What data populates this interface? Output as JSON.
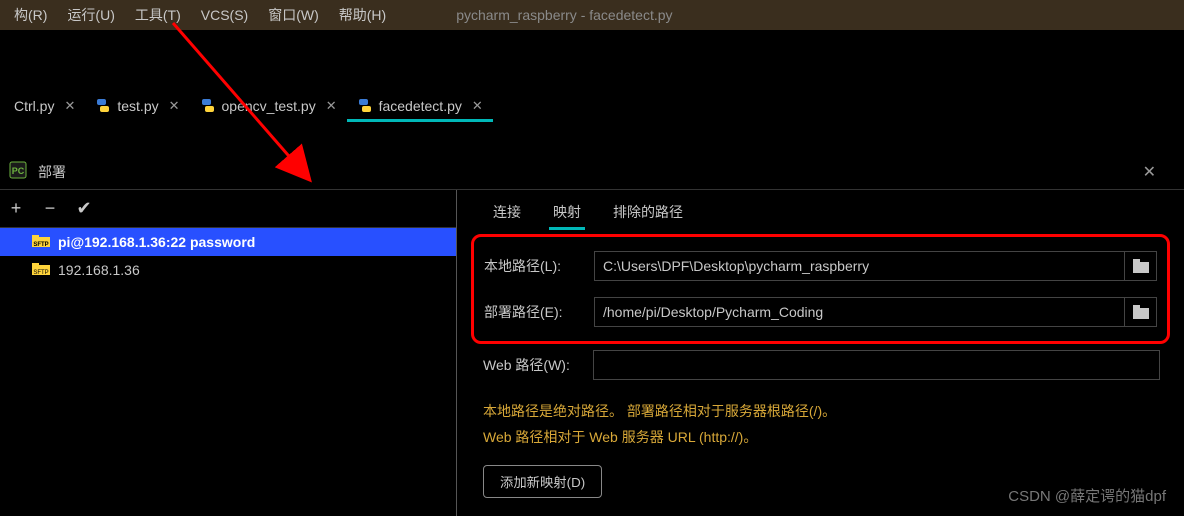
{
  "menubar": {
    "items": [
      {
        "label": "构(R)",
        "ul": "R"
      },
      {
        "label": "运行(U)",
        "ul": "U"
      },
      {
        "label": "工具(T)",
        "ul": "T"
      },
      {
        "label": "VCS(S)",
        "ul": "S"
      },
      {
        "label": "窗口(W)",
        "ul": "W"
      },
      {
        "label": "帮助(H)",
        "ul": "H"
      }
    ],
    "title": "pycharm_raspberry - facedetect.py"
  },
  "tabs": [
    {
      "label": "Ctrl.py",
      "active": false
    },
    {
      "label": "test.py",
      "active": false
    },
    {
      "label": "opencv_test.py",
      "active": false
    },
    {
      "label": "facedetect.py",
      "active": true
    }
  ],
  "deployment": {
    "title": "部署",
    "toolbar": {
      "add": "+",
      "remove": "−",
      "check": "✔"
    },
    "servers": [
      {
        "label": "pi@192.168.1.36:22 password",
        "selected": true
      },
      {
        "label": "192.168.1.36",
        "selected": false
      }
    ],
    "sub_tabs": {
      "connection": "连接",
      "mapping": "映射",
      "exclude": "排除的路径"
    },
    "form": {
      "local_label": "本地路径(L):",
      "local_value": "C:\\Users\\DPF\\Desktop\\pycharm_raspberry",
      "deploy_label": "部署路径(E):",
      "deploy_value": "/home/pi/Desktop/Pycharm_Coding",
      "web_label": "Web 路径(W):",
      "web_value": ""
    },
    "help1": "本地路径是绝对路径。 部署路径相对于服务器根路径(/)。",
    "help2": "Web 路径相对于 Web 服务器 URL (http://)。",
    "add_button": "添加新映射(D)"
  },
  "watermark": "CSDN @薛定谔的猫dpf"
}
